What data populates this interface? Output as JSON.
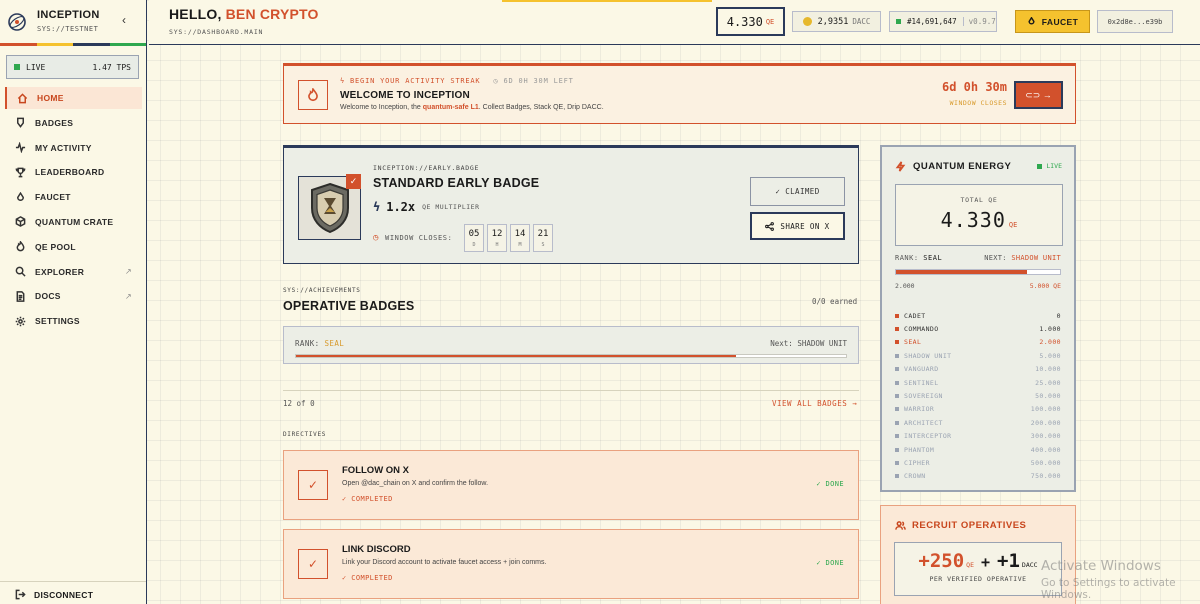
{
  "sidebar": {
    "brand": "INCEPTION",
    "brand_sub": "SYS://TESTNET",
    "live_label": "LIVE",
    "tps": "1.47 TPS",
    "items": [
      {
        "label": "HOME",
        "icon": "home-icon",
        "active": true
      },
      {
        "label": "BADGES",
        "icon": "badge-icon"
      },
      {
        "label": "MY ACTIVITY",
        "icon": "activity-icon"
      },
      {
        "label": "LEADERBOARD",
        "icon": "trophy-icon"
      },
      {
        "label": "FAUCET",
        "icon": "droplet-icon"
      },
      {
        "label": "QUANTUM CRATE",
        "icon": "crate-icon"
      },
      {
        "label": "QE POOL",
        "icon": "flame-icon"
      },
      {
        "label": "EXPLORER",
        "icon": "search-icon",
        "external": true
      },
      {
        "label": "DOCS",
        "icon": "document-icon",
        "external": true
      },
      {
        "label": "SETTINGS",
        "icon": "gear-icon"
      }
    ],
    "disconnect": "DISCONNECT"
  },
  "header": {
    "hello": "HELLO,",
    "name": "BEN CRYPTO",
    "sub": "SYS://DASHBOARD.MAIN",
    "qe_value": "4.330",
    "qe_unit": "QE",
    "dacc_value": "2,9351",
    "dacc_unit": "DACC",
    "block": "#14,691,647",
    "version": "v0.9.7",
    "faucet_label": "FAUCET",
    "address": "0x2d8e...e39b"
  },
  "streak": {
    "kicker": "BEGIN YOUR ACTIVITY STREAK",
    "time_left": "6D 0H 30M LEFT",
    "title": "WELCOME TO INCEPTION",
    "desc_pre": "Welcome to Inception, the",
    "desc_highlight": "quantum-safe L1",
    "desc_post": ". Collect Badges, Stack QE, Drip DACC.",
    "countdown": "6d 0h 30m",
    "countdown_sub": "WINDOW CLOSES",
    "go_label": "GO →"
  },
  "badge": {
    "kicker": "INCEPTION://EARLY.BADGE",
    "title": "STANDARD EARLY BADGE",
    "multiplier": "1.2x",
    "multiplier_label": "QE MULTIPLIER",
    "window_label": "WINDOW CLOSES:",
    "timer": [
      {
        "v": "05",
        "u": "D"
      },
      {
        "v": "12",
        "u": "H"
      },
      {
        "v": "14",
        "u": "M"
      },
      {
        "v": "21",
        "u": "S"
      }
    ],
    "claimed_label": "✓ CLAIMED",
    "share_label": "SHARE ON X"
  },
  "achievements": {
    "kicker": "SYS://ACHIEVEMENTS",
    "title": "OPERATIVE BADGES",
    "earned": "0/0 earned",
    "rank_label": "RANK:",
    "rank_value": "SEAL",
    "next_label": "Next: SHADOW UNIT",
    "progress": 0.8,
    "count": "12 of 0",
    "view_all": "VIEW ALL BADGES →"
  },
  "directives": {
    "kicker": "DIRECTIVES",
    "tasks": [
      {
        "title": "FOLLOW ON X",
        "desc": "Open @dac_chain on X and confirm the follow.",
        "status": "✓ COMPLETED",
        "done": "✓ DONE"
      },
      {
        "title": "LINK DISCORD",
        "desc": "Link your Discord account to activate faucet access + join comms.",
        "status": "✓ COMPLETED",
        "done": "✓ DONE"
      }
    ]
  },
  "qe_panel": {
    "title": "QUANTUM ENERGY",
    "live": "LIVE",
    "total_label": "TOTAL QE",
    "total": "4.330",
    "total_unit": "QE",
    "rank_label": "RANK:",
    "rank": "SEAL",
    "next_label": "NEXT:",
    "next": "SHADOW UNIT",
    "progress": 0.8,
    "min": "2.000",
    "max": "5.000 QE",
    "ranks": [
      {
        "name": "CADET",
        "value": "0",
        "state": "done"
      },
      {
        "name": "COMMANDO",
        "value": "1.000",
        "state": "done"
      },
      {
        "name": "SEAL",
        "value": "2.000",
        "state": "current"
      },
      {
        "name": "SHADOW UNIT",
        "value": "5.000",
        "state": "locked"
      },
      {
        "name": "VANGUARD",
        "value": "10.000",
        "state": "locked"
      },
      {
        "name": "SENTINEL",
        "value": "25.000",
        "state": "locked"
      },
      {
        "name": "SOVEREIGN",
        "value": "50.000",
        "state": "locked"
      },
      {
        "name": "WARRIOR",
        "value": "100.000",
        "state": "locked"
      },
      {
        "name": "ARCHITECT",
        "value": "200.000",
        "state": "locked"
      },
      {
        "name": "INTERCEPTOR",
        "value": "300.000",
        "state": "locked"
      },
      {
        "name": "PHANTOM",
        "value": "400.000",
        "state": "locked"
      },
      {
        "name": "CIPHER",
        "value": "500.000",
        "state": "locked"
      },
      {
        "name": "CROWN",
        "value": "750.000",
        "state": "locked"
      }
    ]
  },
  "recruit": {
    "title": "RECRUIT OPERATIVES",
    "qe_bonus": "+250",
    "qe_unit": "QE",
    "plus": "+",
    "dacc_bonus": "+1",
    "dacc_unit": "DACC",
    "sub": "PER VERIFIED OPERATIVE"
  },
  "watermark": {
    "line1": "Activate Windows",
    "line2": "Go to Settings to activate Windows."
  },
  "colors": {
    "accent": "#d2512c",
    "navy": "#2b3a5a",
    "gold": "#f5c22e",
    "green": "#2fa84f",
    "background": "#fbf8e6"
  }
}
